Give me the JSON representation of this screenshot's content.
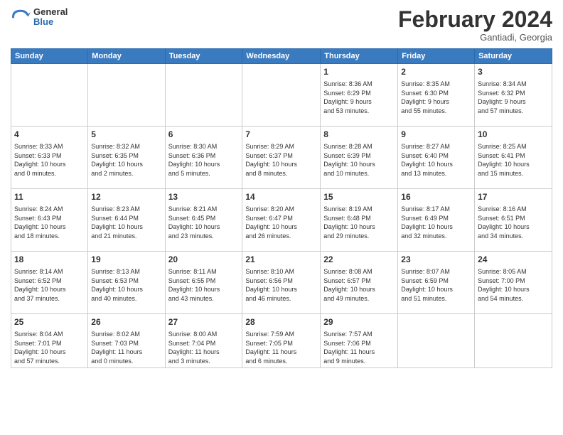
{
  "header": {
    "logo": {
      "general": "General",
      "blue": "Blue"
    },
    "title": "February 2024",
    "subtitle": "Gantiadi, Georgia"
  },
  "calendar": {
    "days_of_week": [
      "Sunday",
      "Monday",
      "Tuesday",
      "Wednesday",
      "Thursday",
      "Friday",
      "Saturday"
    ],
    "weeks": [
      [
        {
          "day": "",
          "info": ""
        },
        {
          "day": "",
          "info": ""
        },
        {
          "day": "",
          "info": ""
        },
        {
          "day": "",
          "info": ""
        },
        {
          "day": "1",
          "info": "Sunrise: 8:36 AM\nSunset: 6:29 PM\nDaylight: 9 hours\nand 53 minutes."
        },
        {
          "day": "2",
          "info": "Sunrise: 8:35 AM\nSunset: 6:30 PM\nDaylight: 9 hours\nand 55 minutes."
        },
        {
          "day": "3",
          "info": "Sunrise: 8:34 AM\nSunset: 6:32 PM\nDaylight: 9 hours\nand 57 minutes."
        }
      ],
      [
        {
          "day": "4",
          "info": "Sunrise: 8:33 AM\nSunset: 6:33 PM\nDaylight: 10 hours\nand 0 minutes."
        },
        {
          "day": "5",
          "info": "Sunrise: 8:32 AM\nSunset: 6:35 PM\nDaylight: 10 hours\nand 2 minutes."
        },
        {
          "day": "6",
          "info": "Sunrise: 8:30 AM\nSunset: 6:36 PM\nDaylight: 10 hours\nand 5 minutes."
        },
        {
          "day": "7",
          "info": "Sunrise: 8:29 AM\nSunset: 6:37 PM\nDaylight: 10 hours\nand 8 minutes."
        },
        {
          "day": "8",
          "info": "Sunrise: 8:28 AM\nSunset: 6:39 PM\nDaylight: 10 hours\nand 10 minutes."
        },
        {
          "day": "9",
          "info": "Sunrise: 8:27 AM\nSunset: 6:40 PM\nDaylight: 10 hours\nand 13 minutes."
        },
        {
          "day": "10",
          "info": "Sunrise: 8:25 AM\nSunset: 6:41 PM\nDaylight: 10 hours\nand 15 minutes."
        }
      ],
      [
        {
          "day": "11",
          "info": "Sunrise: 8:24 AM\nSunset: 6:43 PM\nDaylight: 10 hours\nand 18 minutes."
        },
        {
          "day": "12",
          "info": "Sunrise: 8:23 AM\nSunset: 6:44 PM\nDaylight: 10 hours\nand 21 minutes."
        },
        {
          "day": "13",
          "info": "Sunrise: 8:21 AM\nSunset: 6:45 PM\nDaylight: 10 hours\nand 23 minutes."
        },
        {
          "day": "14",
          "info": "Sunrise: 8:20 AM\nSunset: 6:47 PM\nDaylight: 10 hours\nand 26 minutes."
        },
        {
          "day": "15",
          "info": "Sunrise: 8:19 AM\nSunset: 6:48 PM\nDaylight: 10 hours\nand 29 minutes."
        },
        {
          "day": "16",
          "info": "Sunrise: 8:17 AM\nSunset: 6:49 PM\nDaylight: 10 hours\nand 32 minutes."
        },
        {
          "day": "17",
          "info": "Sunrise: 8:16 AM\nSunset: 6:51 PM\nDaylight: 10 hours\nand 34 minutes."
        }
      ],
      [
        {
          "day": "18",
          "info": "Sunrise: 8:14 AM\nSunset: 6:52 PM\nDaylight: 10 hours\nand 37 minutes."
        },
        {
          "day": "19",
          "info": "Sunrise: 8:13 AM\nSunset: 6:53 PM\nDaylight: 10 hours\nand 40 minutes."
        },
        {
          "day": "20",
          "info": "Sunrise: 8:11 AM\nSunset: 6:55 PM\nDaylight: 10 hours\nand 43 minutes."
        },
        {
          "day": "21",
          "info": "Sunrise: 8:10 AM\nSunset: 6:56 PM\nDaylight: 10 hours\nand 46 minutes."
        },
        {
          "day": "22",
          "info": "Sunrise: 8:08 AM\nSunset: 6:57 PM\nDaylight: 10 hours\nand 49 minutes."
        },
        {
          "day": "23",
          "info": "Sunrise: 8:07 AM\nSunset: 6:59 PM\nDaylight: 10 hours\nand 51 minutes."
        },
        {
          "day": "24",
          "info": "Sunrise: 8:05 AM\nSunset: 7:00 PM\nDaylight: 10 hours\nand 54 minutes."
        }
      ],
      [
        {
          "day": "25",
          "info": "Sunrise: 8:04 AM\nSunset: 7:01 PM\nDaylight: 10 hours\nand 57 minutes."
        },
        {
          "day": "26",
          "info": "Sunrise: 8:02 AM\nSunset: 7:03 PM\nDaylight: 11 hours\nand 0 minutes."
        },
        {
          "day": "27",
          "info": "Sunrise: 8:00 AM\nSunset: 7:04 PM\nDaylight: 11 hours\nand 3 minutes."
        },
        {
          "day": "28",
          "info": "Sunrise: 7:59 AM\nSunset: 7:05 PM\nDaylight: 11 hours\nand 6 minutes."
        },
        {
          "day": "29",
          "info": "Sunrise: 7:57 AM\nSunset: 7:06 PM\nDaylight: 11 hours\nand 9 minutes."
        },
        {
          "day": "",
          "info": ""
        },
        {
          "day": "",
          "info": ""
        }
      ]
    ]
  }
}
